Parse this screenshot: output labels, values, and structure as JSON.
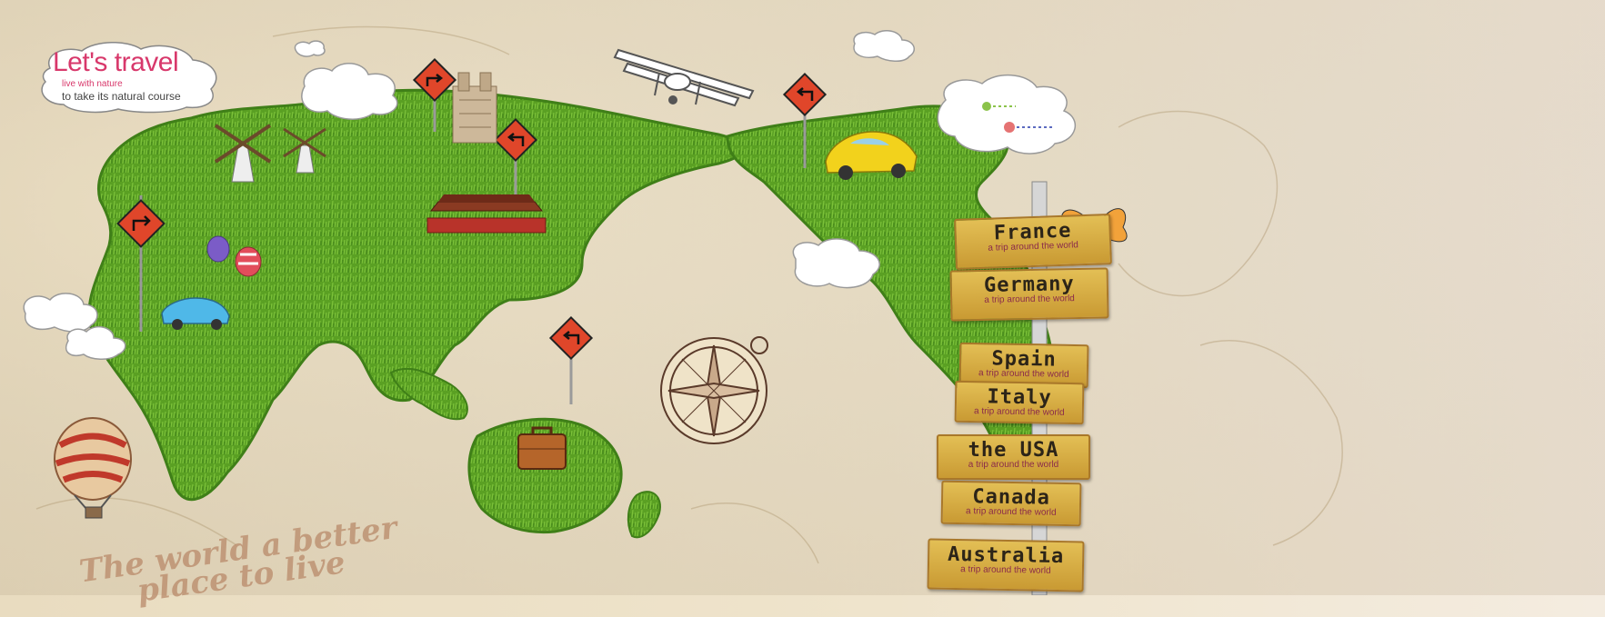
{
  "logo": {
    "title": "Let's travel",
    "line1": "live with nature",
    "line2": "to take its natural course"
  },
  "tagline": {
    "line1": "The world a better",
    "line2": "place to live"
  },
  "destinations": [
    {
      "name": "France",
      "subtitle": "a trip around the world"
    },
    {
      "name": "Germany",
      "subtitle": "a trip around the world"
    },
    {
      "name": "Spain",
      "subtitle": "a trip around the world"
    },
    {
      "name": "Italy",
      "subtitle": "a trip around the world"
    },
    {
      "name": "the USA",
      "subtitle": "a trip around the world"
    },
    {
      "name": "Canada",
      "subtitle": "a trip around the world"
    },
    {
      "name": "Australia",
      "subtitle": "a trip around the world"
    }
  ],
  "colors": {
    "grass": "#5aa023",
    "grass_dark": "#3f7f18",
    "parchment": "#e9dcc0",
    "sign_wood": "#d7ae45",
    "road_sign": "#e0462a",
    "logo_pink": "#d8386b"
  },
  "icons": [
    "road-sign-icon",
    "windmill-icon",
    "airplane-icon",
    "car-icon",
    "hot-air-balloon-icon",
    "compass-icon",
    "suitcase-icon",
    "butterfly-icon",
    "cloud-icon",
    "landmark-icon",
    "gate-icon"
  ]
}
